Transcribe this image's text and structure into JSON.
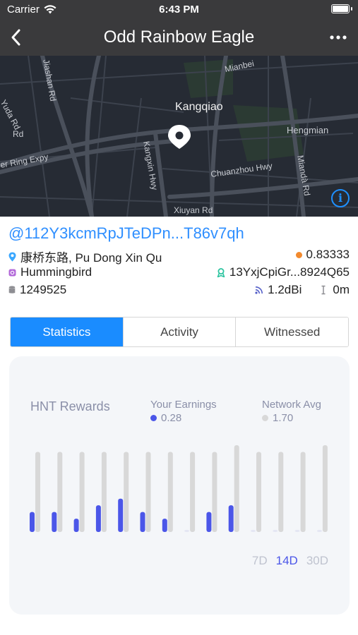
{
  "status_bar": {
    "carrier": "Carrier",
    "time": "6:43 PM"
  },
  "nav": {
    "title": "Odd Rainbow Eagle",
    "more_icon": "ellipsis-icon"
  },
  "map": {
    "labels": {
      "kangqiao": "Kangqiao",
      "hengmian": "Hengmian",
      "yuda_rd": "Yuda Rd",
      "ring_expy": "er Ring Expy",
      "kangxin_hwy": "Kangxin Hwy",
      "chuanzhou_hwy": "Chuanzhou Hwy",
      "xiuyan_rd": "Xiuyan Rd",
      "mianda_rd": "Miandà Rd",
      "mianbei": "Mianbei",
      "jinshan_rd": "Jiashan Rd",
      "rd_short": "Rd"
    }
  },
  "hotspot": {
    "address": "@112Y3kcmRpJTeDPn...T86v7qh",
    "location": "康桥东路, Pu Dong Xin Qu",
    "scale": "0.83333",
    "maker": "Hummingbird",
    "owner": "13YxjCpiGr...8924Q65",
    "block": "1249525",
    "antenna_gain": "1.2dBi",
    "elevation": "0m"
  },
  "colors": {
    "accent": "#1a8cff",
    "scale_dot": "#f28a2e",
    "earnings": "#4b56e8",
    "network": "#d8d8d8",
    "owner_icon": "#2ec4a0",
    "maker_icon": "#b36ad9"
  },
  "tabs": [
    {
      "label": "Statistics",
      "active": true
    },
    {
      "label": "Activity",
      "active": false
    },
    {
      "label": "Witnessed",
      "active": false
    }
  ],
  "rewards": {
    "title": "HNT Rewards",
    "your_earnings_label": "Your Earnings",
    "your_earnings_value": "0.28",
    "network_avg_label": "Network Avg",
    "network_avg_value": "1.70",
    "ranges": [
      {
        "label": "7D",
        "active": false
      },
      {
        "label": "14D",
        "active": true
      },
      {
        "label": "30D",
        "active": false
      }
    ]
  },
  "chart_data": {
    "type": "bar",
    "series": [
      {
        "name": "Your Earnings",
        "values": [
          0.24,
          0.24,
          0.16,
          0.32,
          0.4,
          0.24,
          0.16,
          0.0,
          0.24,
          0.32,
          0.0,
          0.0,
          0.0,
          0.0
        ]
      },
      {
        "name": "Network Avg",
        "values": [
          0.96,
          0.96,
          0.96,
          0.96,
          0.96,
          0.96,
          0.96,
          0.96,
          0.96,
          1.04,
          0.96,
          0.96,
          0.96,
          1.04
        ]
      }
    ],
    "ylim": [
      0,
      1.04
    ],
    "grid": false
  }
}
